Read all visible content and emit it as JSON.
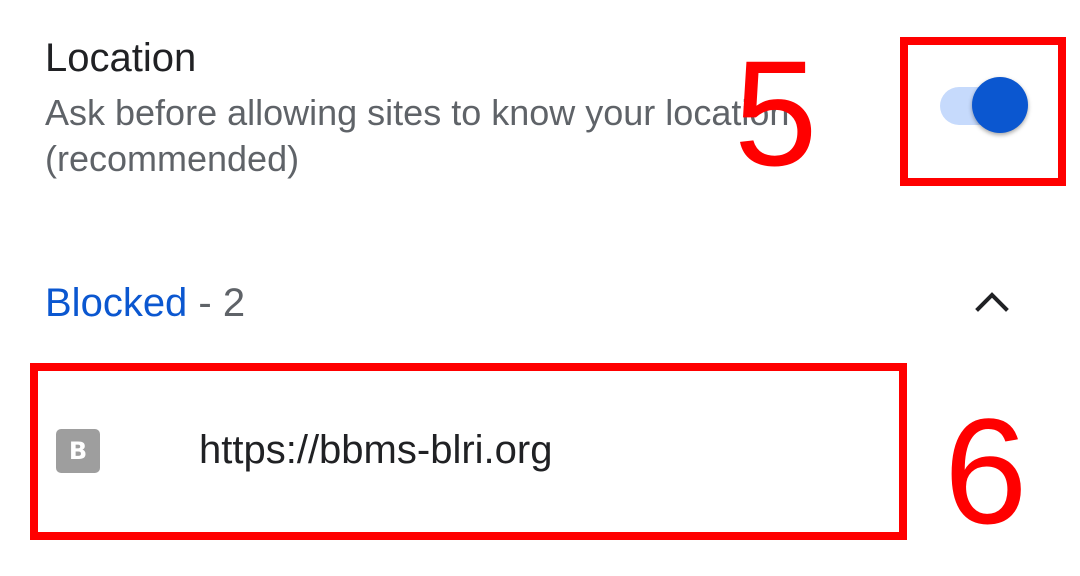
{
  "location_setting": {
    "title": "Location",
    "description": "Ask before allowing sites to know your location (recommended)",
    "toggle_on": true
  },
  "blocked_section": {
    "label": "Blocked",
    "separator": " - ",
    "count": "2",
    "expanded": true,
    "chevron_icon": "chevron-up-icon"
  },
  "sites": [
    {
      "favicon_letter": "B",
      "url": "https://bbms-blri.org"
    }
  ],
  "annotations": [
    {
      "label": "5",
      "target": "toggle"
    },
    {
      "label": "6",
      "target": "site-row"
    }
  ],
  "colors": {
    "accent": "#0b57d0",
    "toggle_track": "#c6dafc",
    "annotation": "#ff0000",
    "favicon_bg": "#9e9e9e"
  }
}
